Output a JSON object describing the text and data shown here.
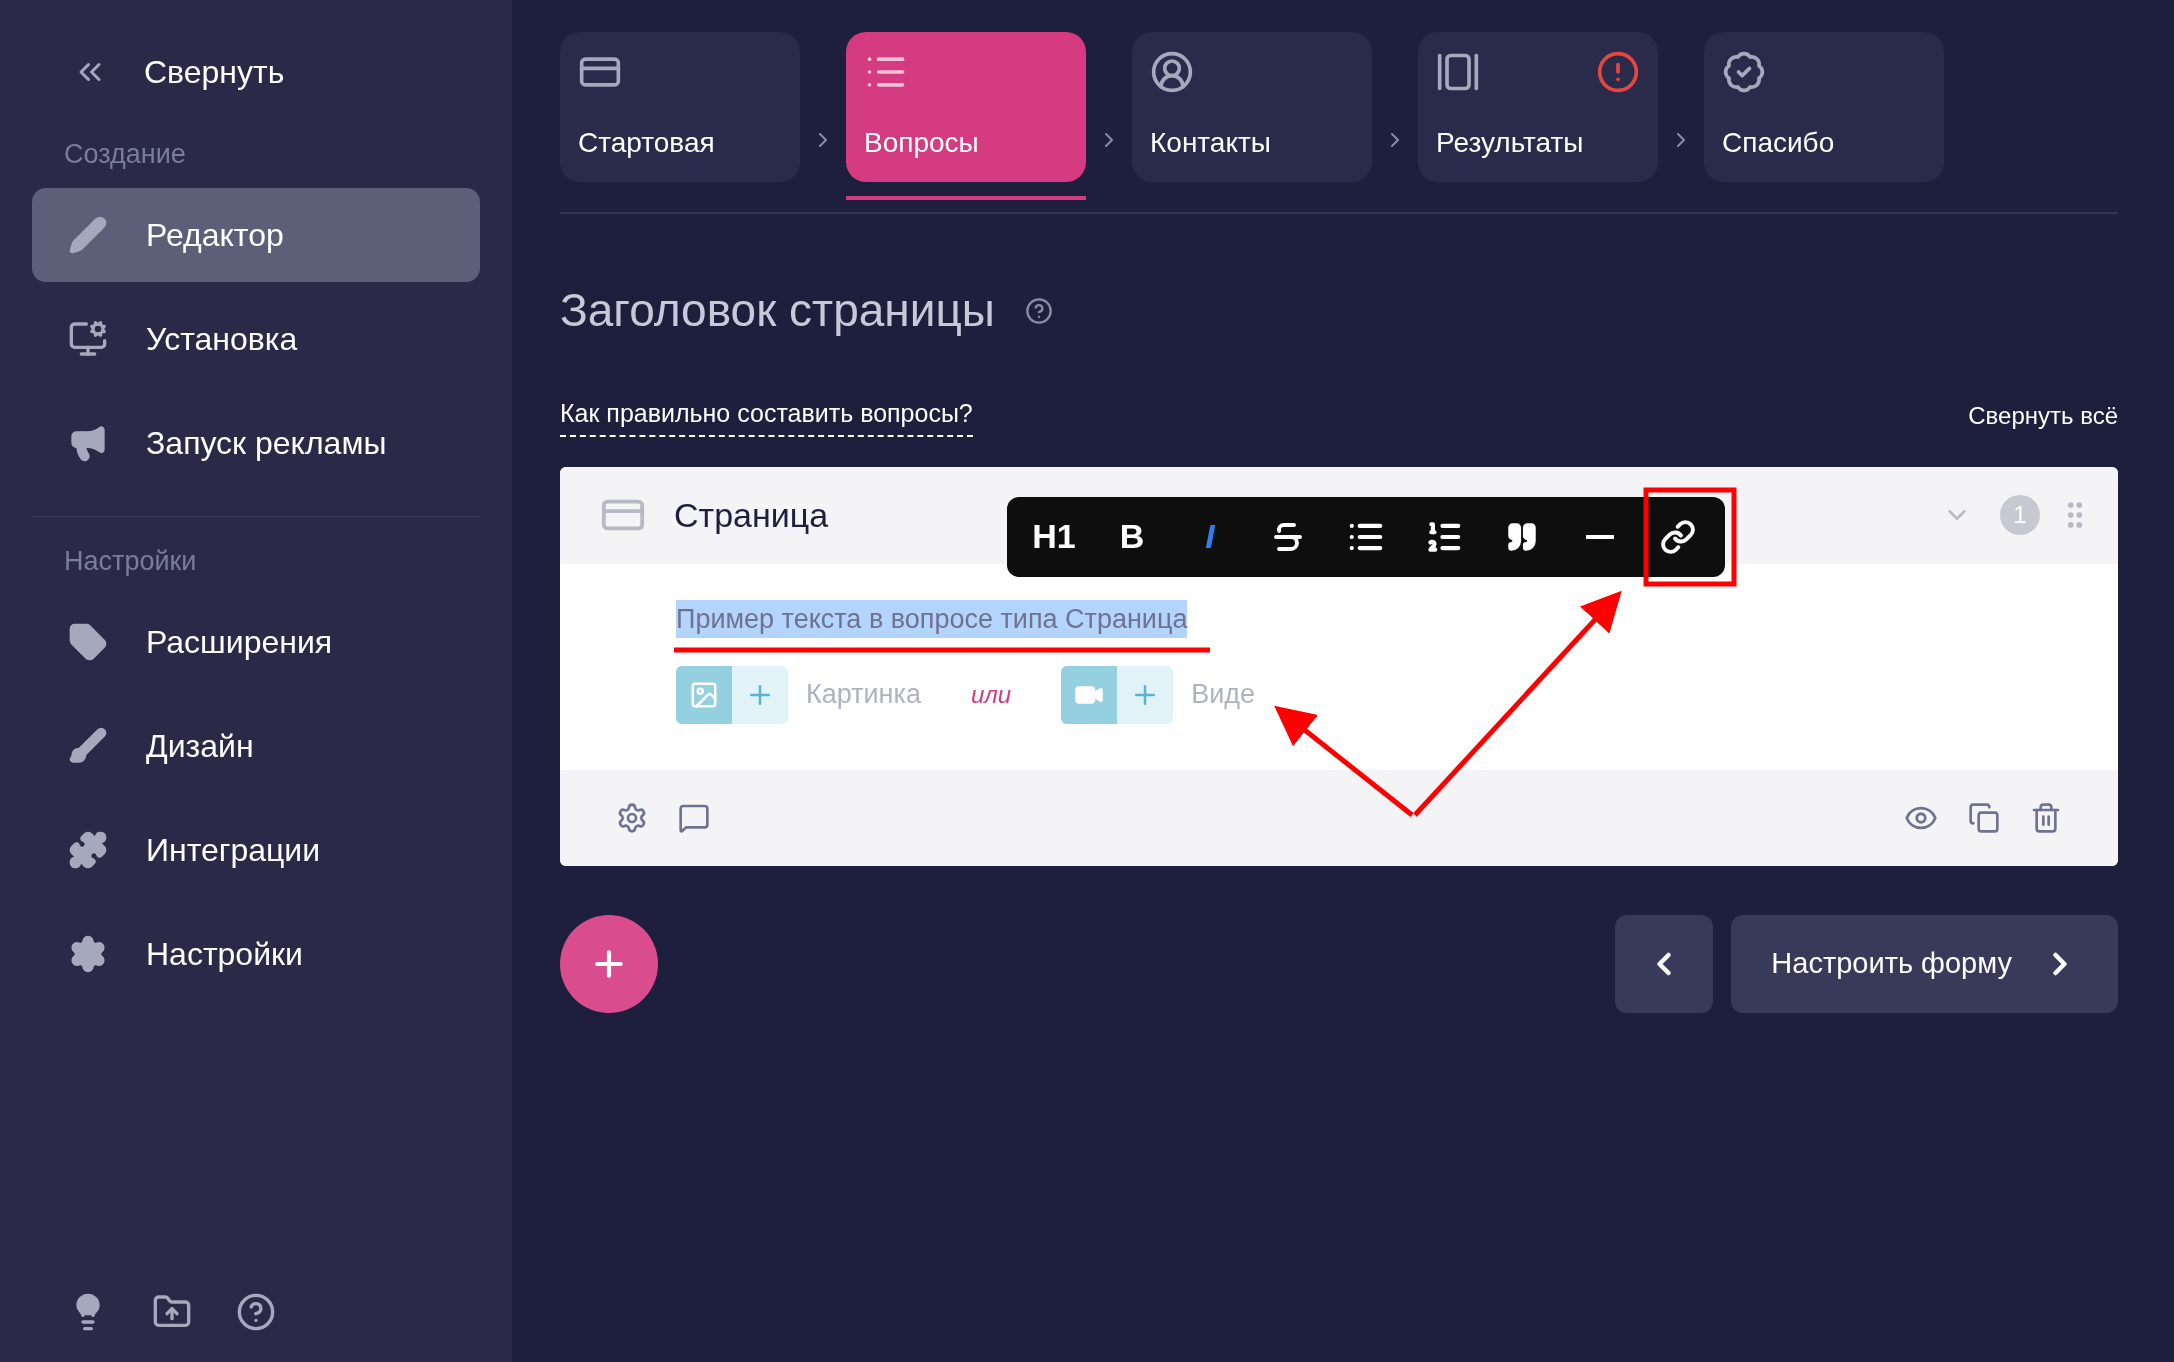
{
  "sidebar": {
    "collapse": "Свернуть",
    "sections": [
      {
        "title": "Создание",
        "items": [
          {
            "label": "Редактор",
            "selected": true
          },
          {
            "label": "Установка",
            "selected": false
          },
          {
            "label": "Запуск рекламы",
            "selected": false
          }
        ]
      },
      {
        "title": "Настройки",
        "items": [
          {
            "label": "Расширения",
            "selected": false
          },
          {
            "label": "Дизайн",
            "selected": false
          },
          {
            "label": "Интеграции",
            "selected": false
          },
          {
            "label": "Настройки",
            "selected": false
          }
        ]
      }
    ]
  },
  "steps": [
    {
      "label": "Стартовая",
      "selected": false,
      "warning": false
    },
    {
      "label": "Вопросы",
      "selected": true,
      "warning": false
    },
    {
      "label": "Контакты",
      "selected": false,
      "warning": false
    },
    {
      "label": "Результаты",
      "selected": false,
      "warning": true
    },
    {
      "label": "Спасибо",
      "selected": false,
      "warning": false
    }
  ],
  "page_title": "Заголовок страницы",
  "help_link": "Как правильно составить вопросы?",
  "collapse_all": "Свернуть всё",
  "card": {
    "title": "Страница",
    "number": "1",
    "text": "Пример текста в вопросе типа Страница",
    "text_selected": true,
    "or": "или",
    "media": [
      {
        "label": "Картинка"
      },
      {
        "label": "Виде"
      }
    ]
  },
  "toolbar": [
    {
      "kind": "text",
      "label": "H1",
      "selected": false
    },
    {
      "kind": "text",
      "label": "B",
      "selected": false
    },
    {
      "kind": "text",
      "label": "I",
      "selected": true
    },
    {
      "kind": "strike",
      "selected": false
    },
    {
      "kind": "bullets",
      "selected": false
    },
    {
      "kind": "numbers",
      "selected": false
    },
    {
      "kind": "quote",
      "selected": false
    },
    {
      "kind": "rule",
      "selected": false
    },
    {
      "kind": "link",
      "selected": false
    }
  ],
  "next_button": "Настроить форму"
}
